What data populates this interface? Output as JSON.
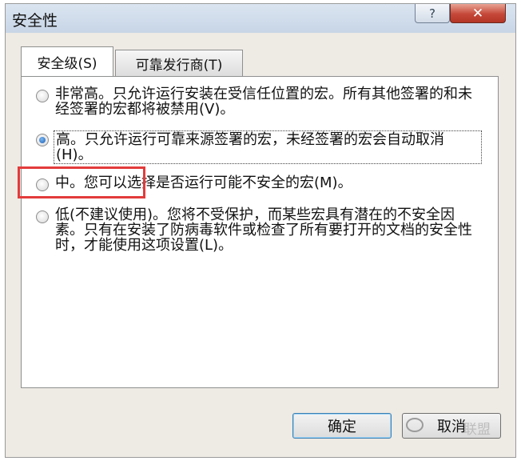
{
  "window": {
    "title": "安全性",
    "help_glyph": "?",
    "close_glyph": "✕"
  },
  "tabs": [
    {
      "label": "安全级(S)",
      "active": true
    },
    {
      "label": "可靠发行商(T)",
      "active": false
    }
  ],
  "options": [
    {
      "text": "非常高。只允许运行安装在受信任位置的宏。所有其他签署的和未经签署的宏都将被禁用(V)。",
      "checked": false
    },
    {
      "text": "高。只允许运行可靠来源签署的宏，未经签署的宏会自动取消(H)。",
      "checked": true
    },
    {
      "text": "中。您可以选择是否运行可能不安全的宏(M)。",
      "checked": false
    },
    {
      "text": "低(不建议使用)。您将不受保护，而某些宏具有潜在的不安全因素。只有在安装了防病毒软件或检查了所有要打开的文档的安全性时，才能使用这项设置(L)。",
      "checked": false
    }
  ],
  "buttons": {
    "ok": "确定",
    "cancel": "取消"
  },
  "watermark": "联盟",
  "colors": {
    "highlight_box": "#e33b3b",
    "radio_selected": "#1d5fb8"
  }
}
